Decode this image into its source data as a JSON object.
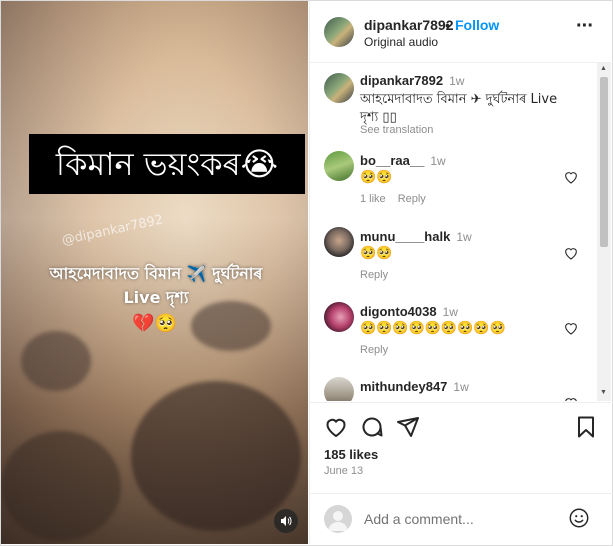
{
  "media": {
    "title_overlay": "কিমান ভয়ংকৰ😭",
    "watermark": "@dipankar7892",
    "caption_line1": "আহমেদাবাদত বিমান ✈️ দুৰ্ঘটনাৰ",
    "caption_line2": "Live দৃশ্য",
    "hearts": "💔🥺",
    "mute_icon": "speaker-icon"
  },
  "header": {
    "username": "dipankar7892",
    "dot": "•",
    "follow_label": "Follow",
    "subtitle": "Original audio",
    "more_icon": "more-horizontal-icon"
  },
  "caption": {
    "username": "dipankar7892",
    "time": "1w",
    "text": "আহমেদাবাদত বিমান ✈ দুৰ্ঘটনাৰ Live",
    "text2": "দৃশ্য ▯▯",
    "see_translation": "See translation"
  },
  "comments": [
    {
      "username": "bo__raa__",
      "time": "1w",
      "text": "🥺🥺",
      "likes": "1 like",
      "reply": "Reply"
    },
    {
      "username": "munu____halk",
      "time": "1w",
      "text": "🥺🥺",
      "reply": "Reply"
    },
    {
      "username": "digonto4038",
      "time": "1w",
      "text": "🥺🥺🥺🥺🥺🥺🥺🥺🥺",
      "reply": "Reply"
    },
    {
      "username": "mithundey847",
      "time": "1w",
      "text": ""
    }
  ],
  "actions": {
    "likes": "185 likes",
    "date": "June 13"
  },
  "add_comment": {
    "placeholder": "Add a comment..."
  },
  "colors": {
    "accent": "#0095f6",
    "text": "#262626",
    "muted": "#8e8e8e"
  }
}
